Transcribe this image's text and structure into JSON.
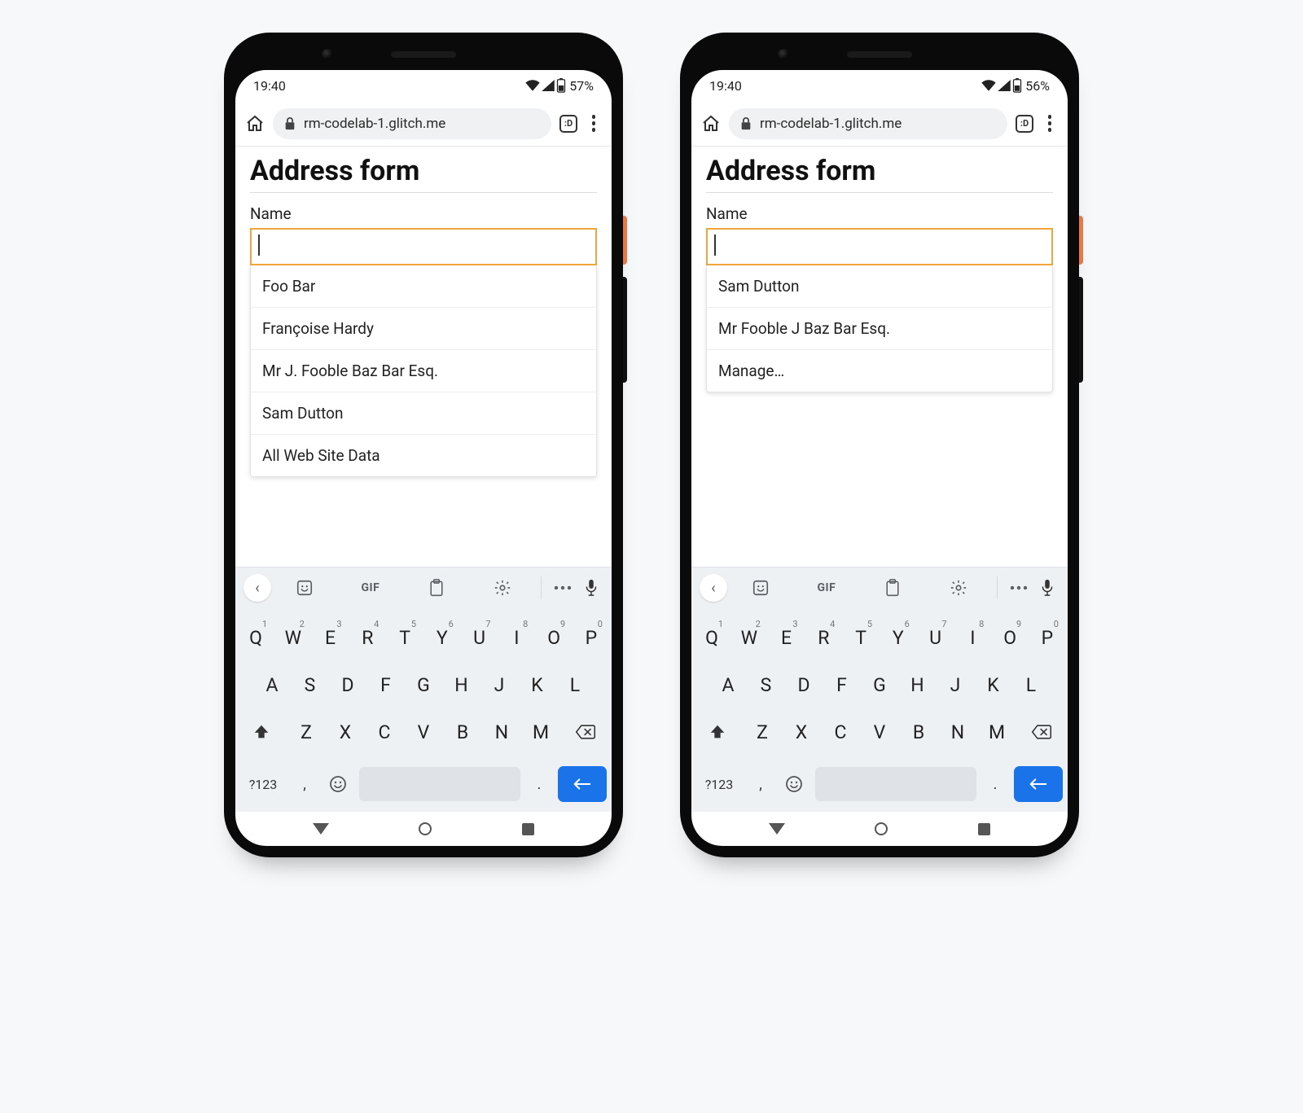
{
  "phones": [
    {
      "status": {
        "time": "19:40",
        "battery": "57%"
      },
      "browser": {
        "url": "rm-codelab-1.glitch.me",
        "tabs": ":D"
      },
      "page": {
        "title": "Address form",
        "name_label": "Name",
        "name_value": "",
        "suggestions": [
          "Foo Bar",
          "Françoise Hardy",
          "Mr J. Fooble Baz Bar Esq.",
          "Sam Dutton",
          "All Web Site Data"
        ]
      }
    },
    {
      "status": {
        "time": "19:40",
        "battery": "56%"
      },
      "browser": {
        "url": "rm-codelab-1.glitch.me",
        "tabs": ":D"
      },
      "page": {
        "title": "Address form",
        "name_label": "Name",
        "name_value": "",
        "suggestions": [
          "Sam Dutton",
          "Mr Fooble J Baz Bar Esq.",
          "Manage…"
        ]
      }
    }
  ],
  "keyboard": {
    "gif_label": "GIF",
    "row1": [
      {
        "k": "Q",
        "n": "1"
      },
      {
        "k": "W",
        "n": "2"
      },
      {
        "k": "E",
        "n": "3"
      },
      {
        "k": "R",
        "n": "4"
      },
      {
        "k": "T",
        "n": "5"
      },
      {
        "k": "Y",
        "n": "6"
      },
      {
        "k": "U",
        "n": "7"
      },
      {
        "k": "I",
        "n": "8"
      },
      {
        "k": "O",
        "n": "9"
      },
      {
        "k": "P",
        "n": "0"
      }
    ],
    "row2": [
      "A",
      "S",
      "D",
      "F",
      "G",
      "H",
      "J",
      "K",
      "L"
    ],
    "row3": [
      "Z",
      "X",
      "C",
      "V",
      "B",
      "N",
      "M"
    ],
    "symbols": "?123",
    "comma": ",",
    "period": "."
  }
}
